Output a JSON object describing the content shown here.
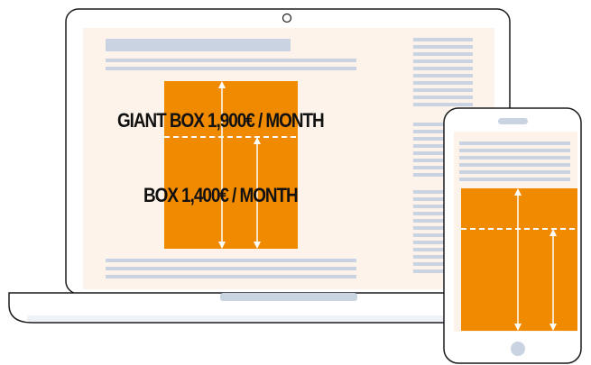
{
  "labels": {
    "giant_box": "GIANT BOX 1,900€ / MONTH",
    "box": "BOX 1,400€ / MONTH"
  },
  "colors": {
    "outline": "#1a1a1a",
    "screen_bg": "#fdf3ea",
    "text_line": "#c9d3e2",
    "ad_box": "#f08a00",
    "arrow": "#ffffff",
    "base": "#eef1f6"
  },
  "icons": [
    "webcam-icon",
    "home-button-icon",
    "speaker-icon"
  ]
}
